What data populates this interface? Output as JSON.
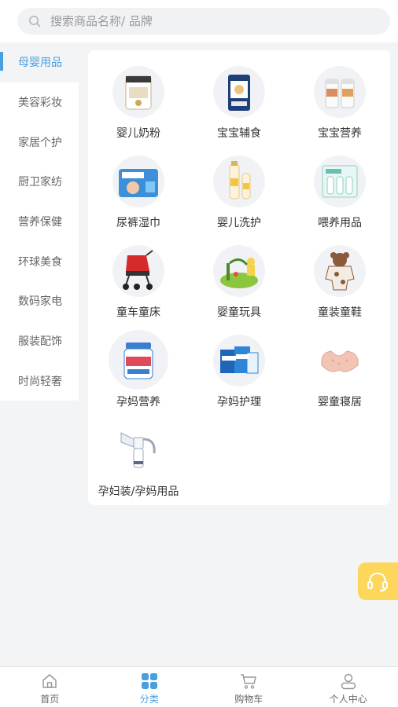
{
  "search": {
    "placeholder": "搜索商品名称/ 品牌",
    "icon": "search-icon"
  },
  "sidebar": {
    "items": [
      {
        "label": "母婴用品",
        "active": true
      },
      {
        "label": "美容彩妆",
        "active": false
      },
      {
        "label": "家居个护",
        "active": false
      },
      {
        "label": "厨卫家纺",
        "active": false
      },
      {
        "label": "营养保健",
        "active": false
      },
      {
        "label": "环球美食",
        "active": false
      },
      {
        "label": "数码家电",
        "active": false
      },
      {
        "label": "服装配饰",
        "active": false
      },
      {
        "label": "时尚轻奢",
        "active": false
      }
    ]
  },
  "categories": [
    {
      "label": "婴儿奶粉",
      "icon": "milk-powder-can-icon"
    },
    {
      "label": "宝宝辅食",
      "icon": "baby-food-jar-icon"
    },
    {
      "label": "宝宝营养",
      "icon": "supplement-bottles-icon"
    },
    {
      "label": "尿裤湿巾",
      "icon": "diaper-pack-icon"
    },
    {
      "label": "婴儿洗护",
      "icon": "baby-lotion-icon"
    },
    {
      "label": "喂养用品",
      "icon": "feeding-bottles-icon"
    },
    {
      "label": "童车童床",
      "icon": "stroller-icon"
    },
    {
      "label": "婴童玩具",
      "icon": "toy-playset-icon"
    },
    {
      "label": "童装童鞋",
      "icon": "bear-romper-icon"
    },
    {
      "label": "孕妈营养",
      "icon": "prenatal-vitamin-icon"
    },
    {
      "label": "孕妈护理",
      "icon": "maternity-care-kit-icon"
    },
    {
      "label": "婴童寝居",
      "icon": "baby-pillow-icon"
    },
    {
      "label": "孕妇装/孕妈用品",
      "icon": "breast-pump-icon"
    }
  ],
  "tabbar": {
    "items": [
      {
        "label": "首页",
        "icon": "home-icon",
        "active": false
      },
      {
        "label": "分类",
        "icon": "grid-category-icon",
        "active": true
      },
      {
        "label": "购物车",
        "icon": "cart-icon",
        "active": false
      },
      {
        "label": "个人中心",
        "icon": "user-icon",
        "active": false
      }
    ]
  },
  "colors": {
    "accent": "#4a9fe0",
    "float_button": "#fcd75c",
    "background": "#f3f4f6"
  },
  "float_button": {
    "icon": "headset-icon"
  }
}
